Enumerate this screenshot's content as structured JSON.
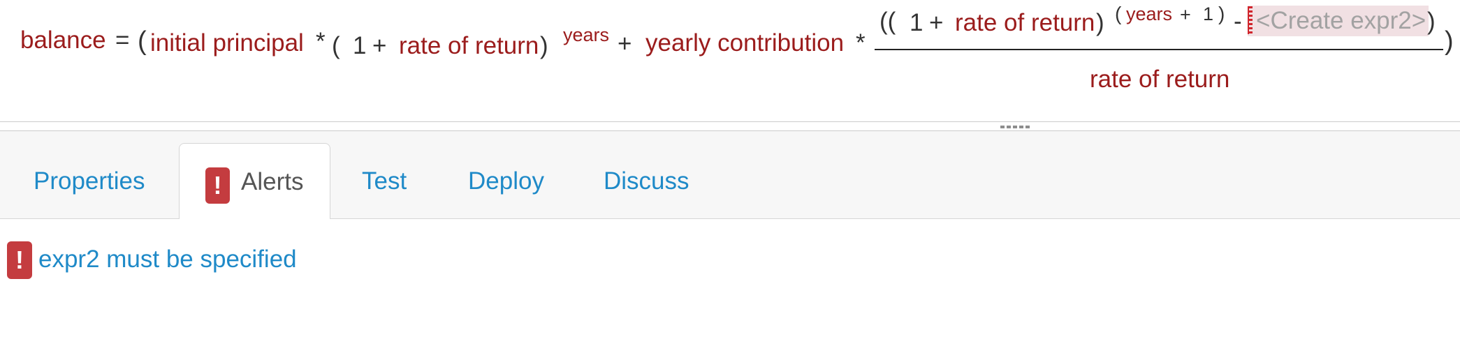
{
  "formula": {
    "balance": "balance",
    "equals": "=",
    "open_paren": "(",
    "initial_principal": "initial principal",
    "times": "*",
    "open_paren_small": "(",
    "one": "1",
    "plus": "+",
    "rate_of_return": "rate of return",
    "close_paren": ")",
    "years": "years",
    "plus_2": "+",
    "yearly_contribution": "yearly contribution",
    "times_2": "*",
    "numerator_open_parens": "((",
    "numerator_one": "1",
    "numerator_plus": "+",
    "numerator_rate_of_return": "rate of return",
    "numerator_close_paren": ")",
    "exp_open_paren": "(",
    "exp_years": "years",
    "exp_plus": "+",
    "exp_one": "1",
    "exp_close_paren": ")",
    "minus": "-",
    "placeholder": "<Create expr2>",
    "placeholder_close_paren": ")",
    "outer_close_paren": ")",
    "denominator": "rate of return"
  },
  "tabs": {
    "properties": "Properties",
    "alerts": "Alerts",
    "alerts_icon": "!",
    "test": "Test",
    "deploy": "Deploy",
    "discuss": "Discuss",
    "active": "Alerts"
  },
  "alerts": {
    "items": [
      {
        "icon": "!",
        "message": "expr2 must be specified"
      }
    ]
  },
  "colors": {
    "variable": "#9b1c1c",
    "operator": "#333333",
    "link": "#1f8ac8",
    "alert_badge": "#c43c3f",
    "placeholder_bg": "#f1e0e3",
    "placeholder_text": "#a2a2a2"
  },
  "icons": {
    "alerts_tab_icon": "exclamation-badge-icon",
    "alert_item_icon": "exclamation-badge-icon",
    "splitter_grip": "drag-grip-icon"
  }
}
